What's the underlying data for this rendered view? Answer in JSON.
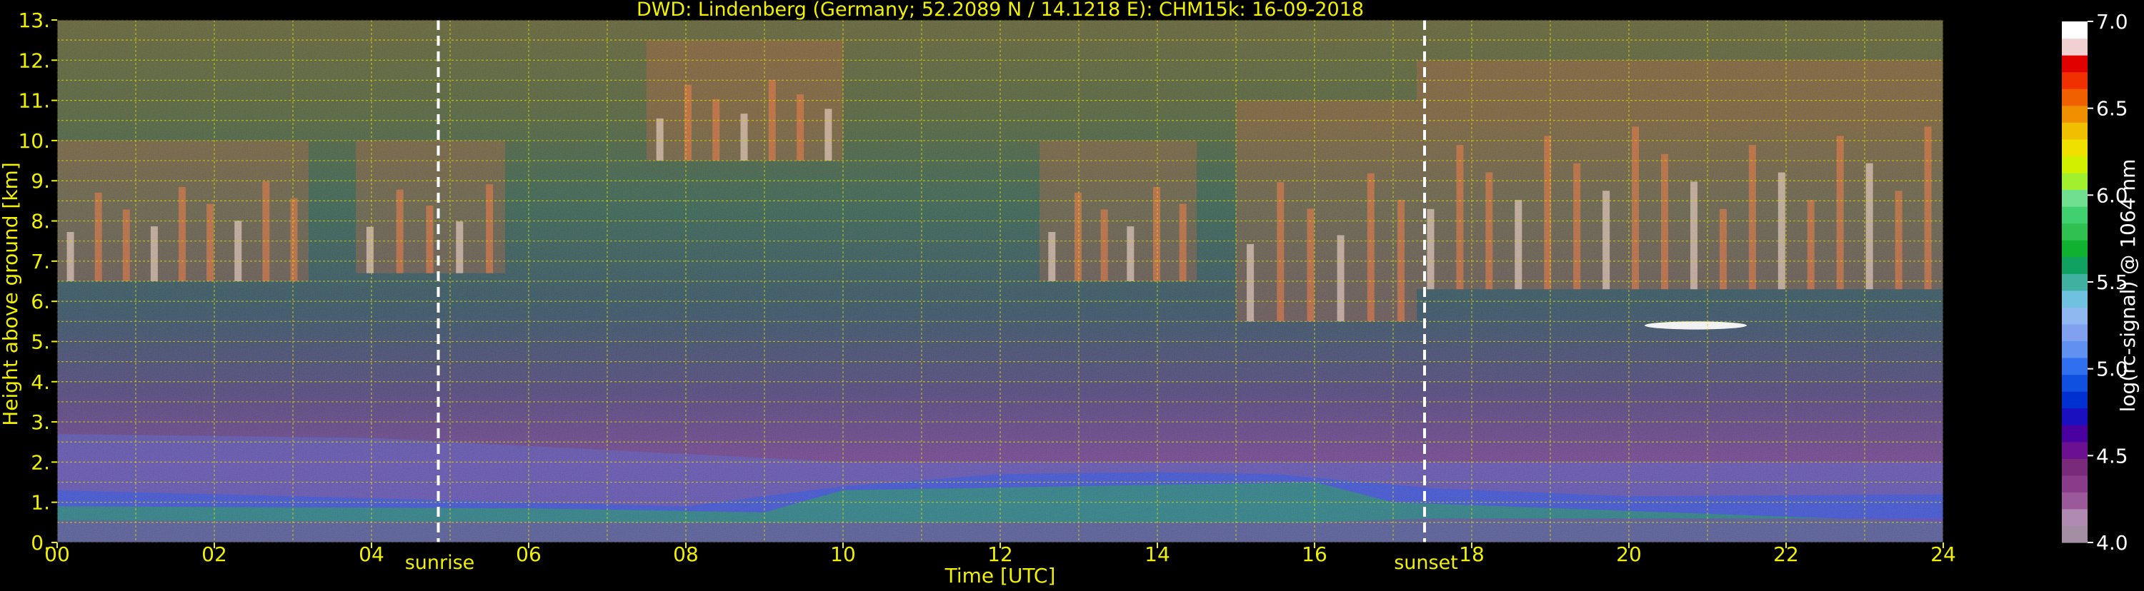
{
  "chart_data": {
    "type": "heatmap",
    "title": "DWD: Lindenberg (Germany; 52.2089 N / 14.1218 E):    CHM15k: 16-09-2018",
    "xlabel": "Time [UTC]",
    "ylabel": "Height above ground [km]",
    "xlim": [
      0,
      24
    ],
    "ylim": [
      0,
      13
    ],
    "x_ticks": [
      "00",
      "02",
      "04",
      "06",
      "08",
      "10",
      "12",
      "14",
      "16",
      "18",
      "20",
      "22",
      "24"
    ],
    "y_ticks": [
      "0.",
      "1.",
      "2.",
      "3.",
      "4.",
      "5.",
      "6.",
      "7.",
      "8.",
      "9.",
      "10.",
      "11.",
      "12.",
      "13."
    ],
    "grid": true,
    "colorbar": {
      "label": "log(rc-signal) @ 1064 nm",
      "range": [
        4.0,
        7.0
      ],
      "ticks": [
        "4.0",
        "4.5",
        "5.0",
        "5.5",
        "6.0",
        "6.5",
        "7.0"
      ],
      "colors": [
        "#a48ea4",
        "#b08ab0",
        "#9a5a9a",
        "#8a3c8a",
        "#7a2a7a",
        "#6a1090",
        "#4a00a0",
        "#1a10c0",
        "#0030d0",
        "#1050e0",
        "#3070f0",
        "#6090f0",
        "#80a0f0",
        "#90b8f0",
        "#70c0e0",
        "#40b0a0",
        "#10a060",
        "#10b030",
        "#30c050",
        "#40d070",
        "#70e090",
        "#a0f030",
        "#d0f000",
        "#f0e000",
        "#f0c000",
        "#f09000",
        "#f06000",
        "#f03000",
        "#e00000",
        "#f0d0d0",
        "#ffffff"
      ]
    },
    "events": [
      {
        "label": "sunrise",
        "time": 4.85
      },
      {
        "label": "sunset",
        "time": 17.4
      }
    ],
    "layers": [
      {
        "type": "boundary layer",
        "x": [
          0,
          4,
          8,
          10,
          12,
          14,
          15.5,
          17.5,
          20,
          24
        ],
        "top_km": [
          1.3,
          1.1,
          0.9,
          1.4,
          1.7,
          1.75,
          1.7,
          1.35,
          1.15,
          1.2
        ]
      },
      {
        "type": "residual layer top",
        "x": [
          0,
          4,
          8,
          10,
          24
        ],
        "top_km": [
          2.7,
          2.6,
          2.2,
          2.0,
          2.0
        ]
      },
      {
        "type": "cirrus",
        "x_start": 0,
        "x_end": 3.2,
        "base_km": 6.5,
        "top_km": 10.0
      },
      {
        "type": "cirrus",
        "x_start": 3.8,
        "x_end": 5.7,
        "base_km": 6.7,
        "top_km": 10.0
      },
      {
        "type": "cirrus",
        "x_start": 7.5,
        "x_end": 10.0,
        "base_km": 9.5,
        "top_km": 12.5
      },
      {
        "type": "cirrus",
        "x_start": 12.5,
        "x_end": 14.5,
        "base_km": 6.5,
        "top_km": 10.0
      },
      {
        "type": "cirrus",
        "x_start": 15.0,
        "x_end": 17.3,
        "base_km": 5.5,
        "top_km": 11.0
      },
      {
        "type": "cirrus",
        "x_start": 17.3,
        "x_end": 24,
        "base_km": 6.3,
        "top_km": 12.0
      },
      {
        "type": "cloud",
        "x_start": 20.2,
        "x_end": 21.5,
        "base_km": 5.3,
        "top_km": 5.5
      }
    ]
  }
}
